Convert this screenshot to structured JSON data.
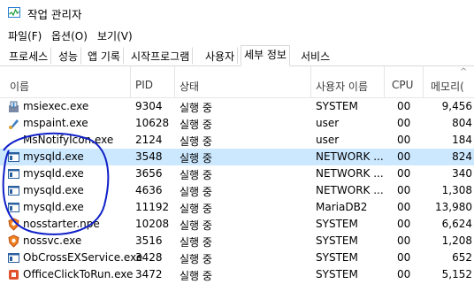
{
  "window": {
    "title": "작업 관리자"
  },
  "menu": [
    "파일(F)",
    "옵션(O)",
    "보기(V)"
  ],
  "tabs": [
    "프로세스",
    "성능",
    "앱 기록",
    "시작프로그램",
    "사용자",
    "세부 정보",
    "서비스"
  ],
  "active_tab": "세부 정보",
  "columns": {
    "name": "이름",
    "pid": "PID",
    "status": "상태",
    "user": "사용자 이름",
    "cpu": "CPU",
    "mem": "메모리("
  },
  "sort_indicator": "^",
  "rows": [
    {
      "icon": "installer-icon",
      "name": "msiexec.exe",
      "pid": "9304",
      "status": "실행 중",
      "user": "SYSTEM",
      "cpu": "00",
      "mem": "9,456"
    },
    {
      "icon": "paint-icon",
      "name": "mspaint.exe",
      "pid": "10628",
      "status": "실행 중",
      "user": "user",
      "cpu": "00",
      "mem": "804"
    },
    {
      "icon": "blank-icon",
      "name": "MsNotifyIcon.exe",
      "pid": "2124",
      "status": "실행 중",
      "user": "user",
      "cpu": "00",
      "mem": "184"
    },
    {
      "icon": "window-icon",
      "name": "mysqld.exe",
      "pid": "3548",
      "status": "실행 중",
      "user": "NETWORK ...",
      "cpu": "00",
      "mem": "824",
      "selected": true
    },
    {
      "icon": "window-icon",
      "name": "mysqld.exe",
      "pid": "3656",
      "status": "실행 중",
      "user": "NETWORK ...",
      "cpu": "00",
      "mem": "340"
    },
    {
      "icon": "window-icon",
      "name": "mysqld.exe",
      "pid": "4636",
      "status": "실행 중",
      "user": "NETWORK ...",
      "cpu": "00",
      "mem": "1,308"
    },
    {
      "icon": "window-icon",
      "name": "mysqld.exe",
      "pid": "11192",
      "status": "실행 중",
      "user": "MariaDB2",
      "cpu": "00",
      "mem": "13,980"
    },
    {
      "icon": "shield-orange-icon",
      "name": "nosstarter.npe",
      "pid": "10208",
      "status": "실행 중",
      "user": "SYSTEM",
      "cpu": "00",
      "mem": "6,624"
    },
    {
      "icon": "shield-orange-icon",
      "name": "nossvc.exe",
      "pid": "3516",
      "status": "실행 중",
      "user": "SYSTEM",
      "cpu": "00",
      "mem": "1,208"
    },
    {
      "icon": "window-icon",
      "name": "ObCrossEXService.exe",
      "pid": "3428",
      "status": "실행 중",
      "user": "SYSTEM",
      "cpu": "00",
      "mem": "652"
    },
    {
      "icon": "office-icon",
      "name": "OfficeClickToRun.exe",
      "pid": "3472",
      "status": "실행 중",
      "user": "SYSTEM",
      "cpu": "00",
      "mem": "5,152"
    }
  ],
  "annotation": {
    "shape": "hand-drawn-circle",
    "color": "#1020c8"
  }
}
